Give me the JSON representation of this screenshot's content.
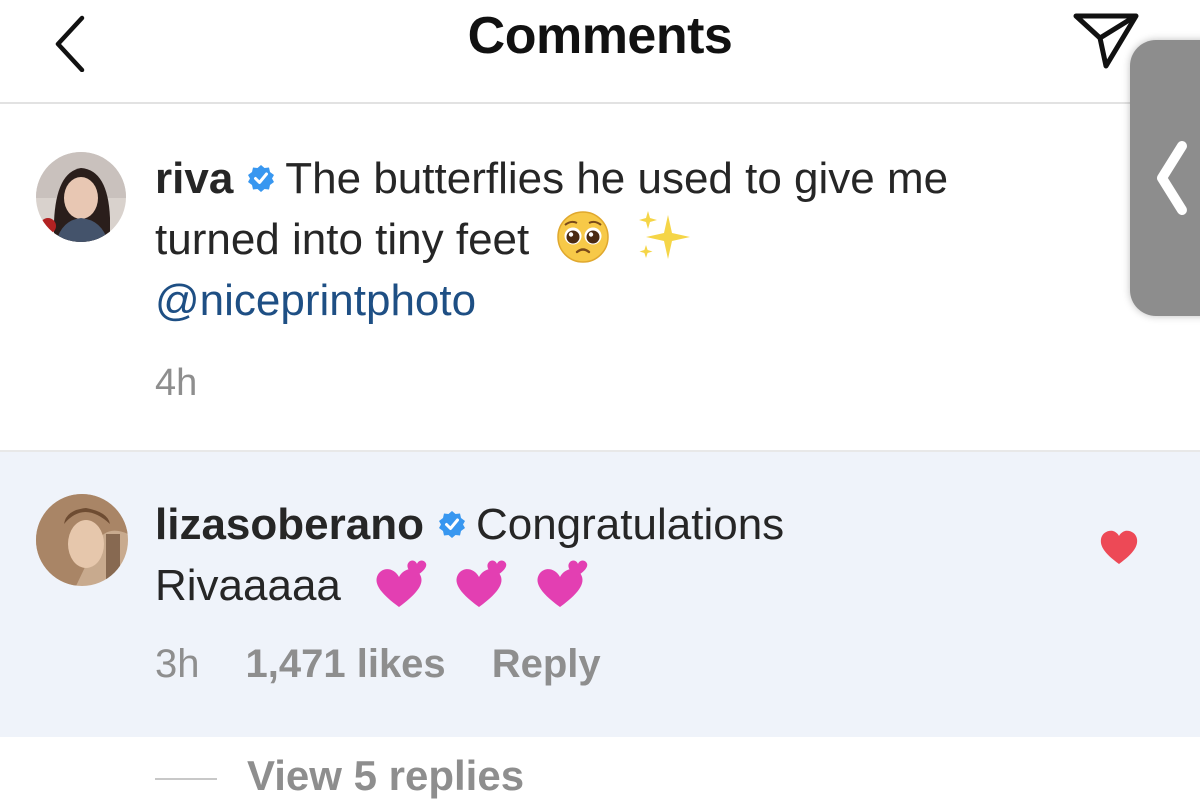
{
  "header": {
    "title": "Comments",
    "back_icon": "chevron-left-icon",
    "share_icon": "paper-plane-icon"
  },
  "caption": {
    "username": "riva",
    "verified_icon": "verified-badge-icon",
    "text_line1": "The butterflies he used to give me",
    "text_line2": "turned into tiny feet",
    "emojis": [
      "pleading-face-emoji",
      "sparkles-emoji"
    ],
    "mention": "@niceprintphoto",
    "time": "4h"
  },
  "reply": {
    "username": "lizasoberano",
    "verified_icon": "verified-badge-icon",
    "text_line1": "Congratulations",
    "text_line2": "Rivaaaaa",
    "emojis": [
      "two-hearts-emoji",
      "two-hearts-emoji",
      "two-hearts-emoji"
    ],
    "time": "3h",
    "likes": "1,471 likes",
    "reply_label": "Reply",
    "liked": true
  },
  "view_replies": "View 5 replies",
  "colors": {
    "mention": "#1e4f84",
    "verified": "#3897f0",
    "heart": "#ed4956",
    "muted": "#8e8e8e",
    "highlight_bg": "#eff3fa"
  }
}
